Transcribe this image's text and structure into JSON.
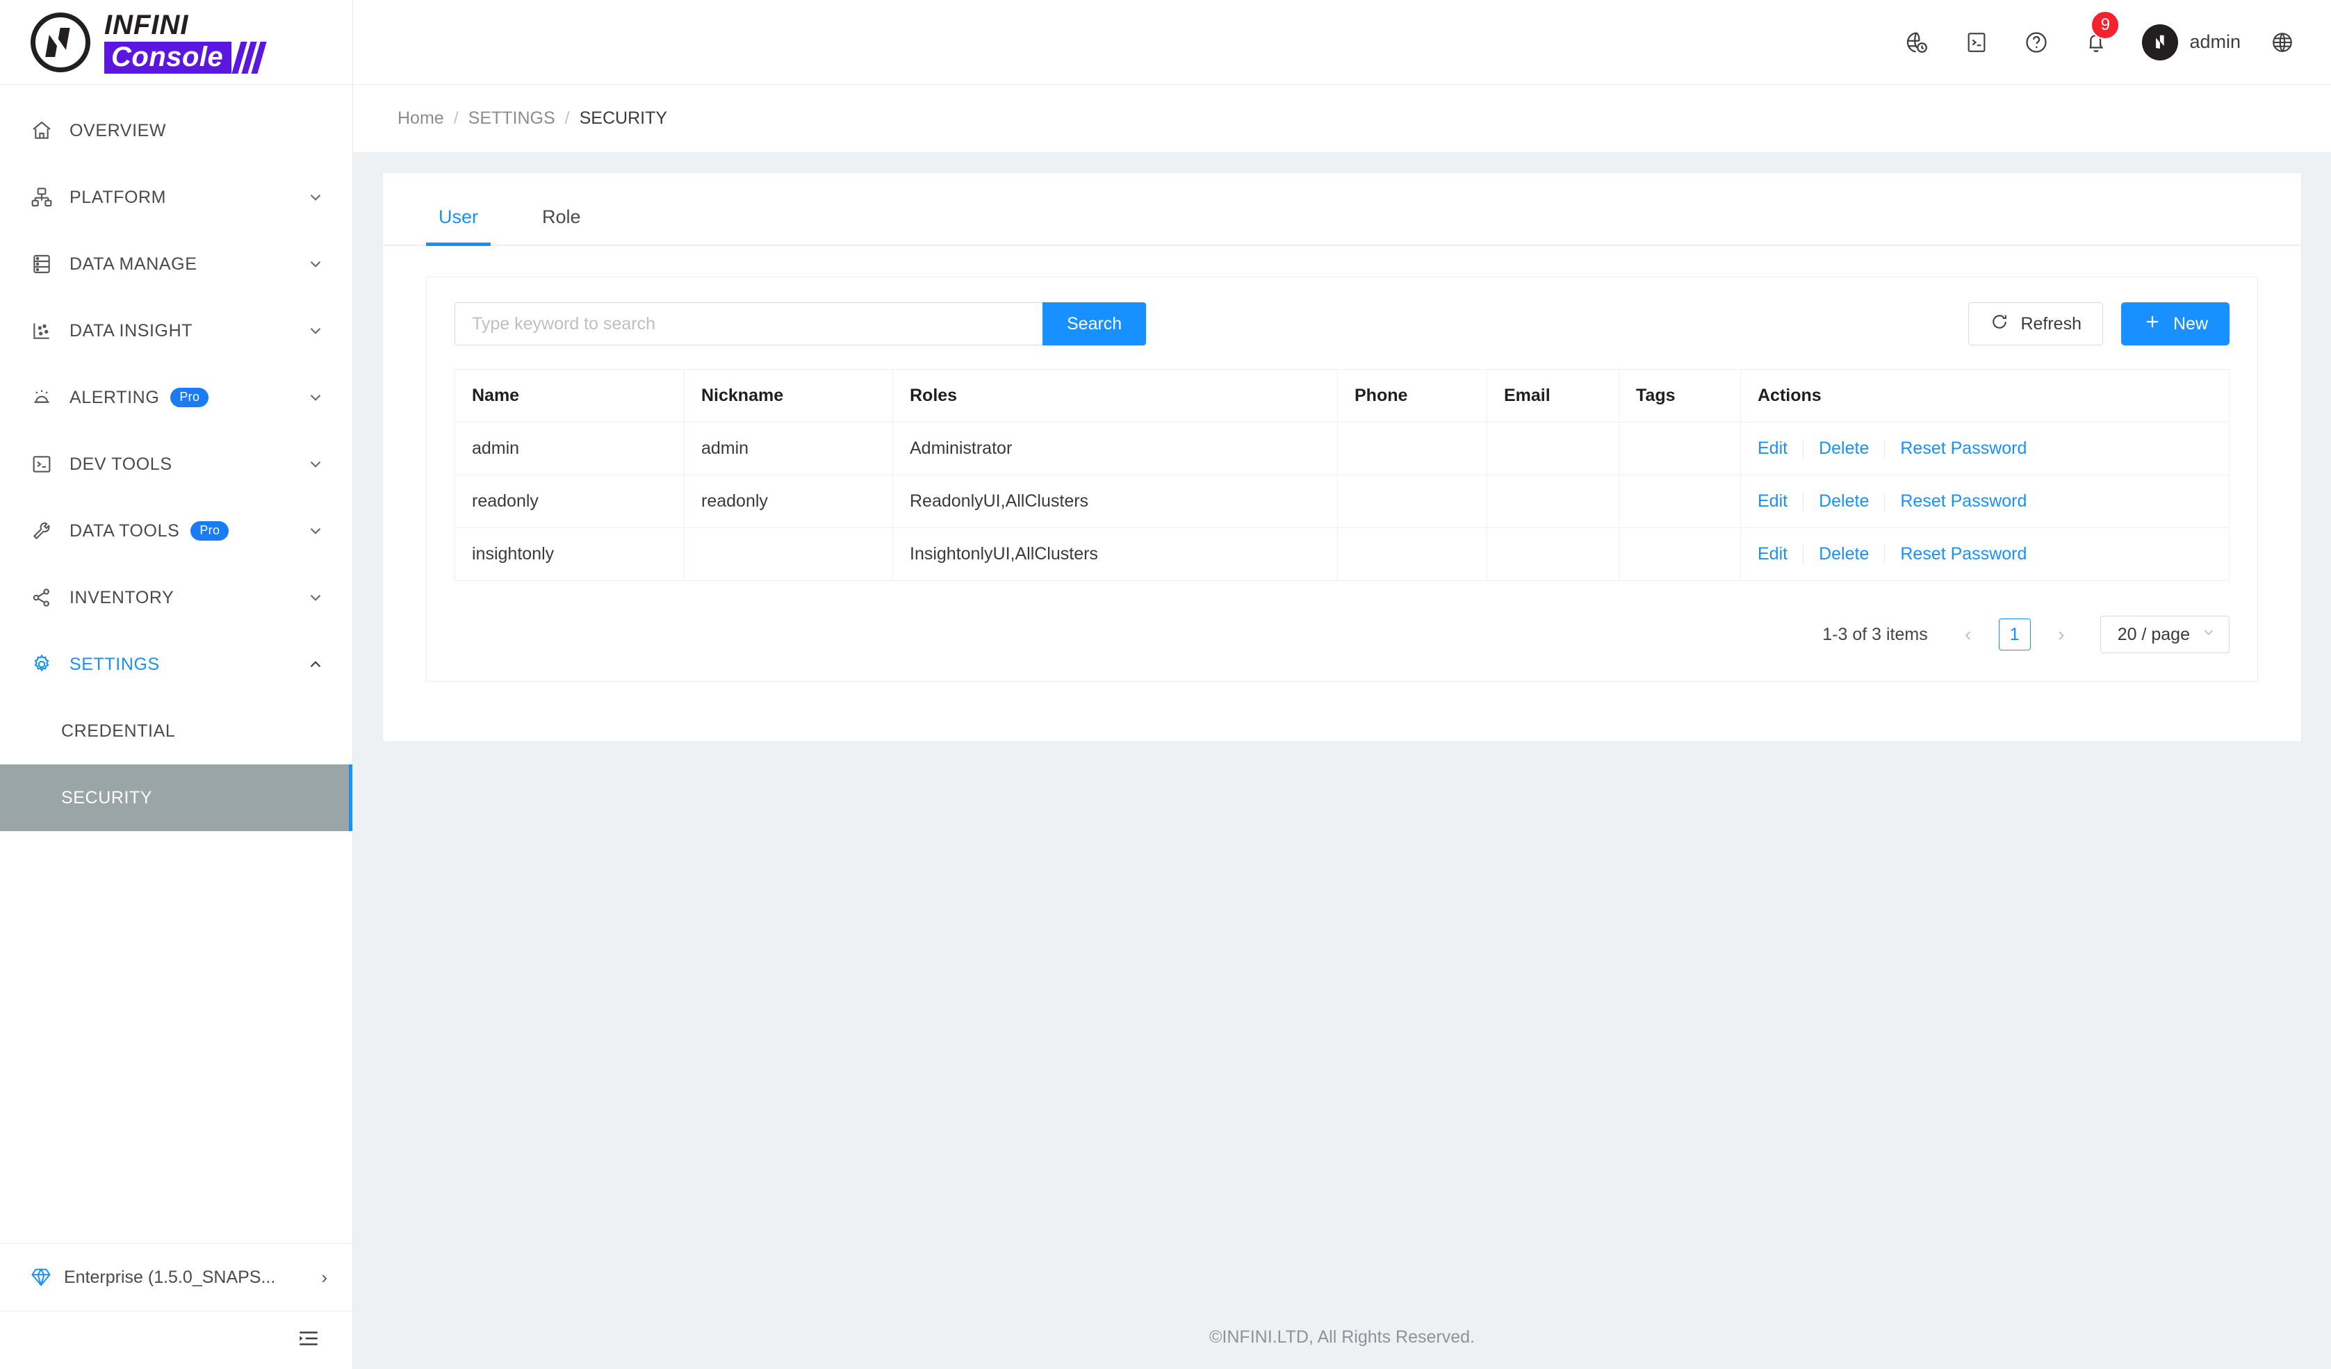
{
  "brand": {
    "name_top": "INFINI",
    "name_bottom": "Console",
    "purple": "#5b17e0"
  },
  "sidebar": {
    "items": [
      {
        "label": "OVERVIEW",
        "icon": "home-icon",
        "expandable": false,
        "badge": ""
      },
      {
        "label": "PLATFORM",
        "icon": "platform-icon",
        "expandable": true,
        "badge": ""
      },
      {
        "label": "DATA MANAGE",
        "icon": "database-icon",
        "expandable": true,
        "badge": ""
      },
      {
        "label": "DATA INSIGHT",
        "icon": "chart-icon",
        "expandable": true,
        "badge": ""
      },
      {
        "label": "ALERTING",
        "icon": "alarm-icon",
        "expandable": true,
        "badge": "Pro"
      },
      {
        "label": "DEV TOOLS",
        "icon": "terminal-icon",
        "expandable": true,
        "badge": ""
      },
      {
        "label": "DATA TOOLS",
        "icon": "wrench-icon",
        "expandable": true,
        "badge": "Pro"
      },
      {
        "label": "INVENTORY",
        "icon": "share-nodes-icon",
        "expandable": true,
        "badge": ""
      },
      {
        "label": "SETTINGS",
        "icon": "gear-icon",
        "expandable": true,
        "badge": "",
        "active": true
      }
    ],
    "sub_items": [
      {
        "label": "CREDENTIAL",
        "selected": false
      },
      {
        "label": "SECURITY",
        "selected": true
      }
    ],
    "footer": {
      "edition": "Enterprise (1.5.0_SNAPS...",
      "gem_icon": "gem-icon",
      "arrow_icon": "chevron-right-icon",
      "collapse_icon": "collapse-menu-icon"
    },
    "accent": "#1890ff",
    "selected_bg": "#9aa5a8"
  },
  "topbar": {
    "icons": [
      {
        "name": "globe-clock-icon"
      },
      {
        "name": "console-terminal-icon"
      },
      {
        "name": "help-circle-icon"
      }
    ],
    "notification": {
      "icon": "bell-icon",
      "count": "9",
      "color": "#f5222d"
    },
    "user": {
      "avatar_icon": "infini-avatar-icon",
      "name": "admin"
    },
    "language": {
      "icon": "globe-icon"
    }
  },
  "breadcrumb": {
    "items": [
      {
        "label": "Home",
        "current": false
      },
      {
        "label": "SETTINGS",
        "current": false
      },
      {
        "label": "SECURITY",
        "current": true
      }
    ],
    "separator": "/"
  },
  "tabs": [
    {
      "label": "User",
      "active": true
    },
    {
      "label": "Role",
      "active": false
    }
  ],
  "toolbar": {
    "search_placeholder": "Type keyword to search",
    "search_value": "",
    "search_label": "Search",
    "refresh_label": "Refresh",
    "refresh_icon": "refresh-icon",
    "new_label": "New",
    "new_icon": "plus-icon"
  },
  "table": {
    "columns": [
      "Name",
      "Nickname",
      "Roles",
      "Phone",
      "Email",
      "Tags",
      "Actions"
    ],
    "rows": [
      {
        "name": "admin",
        "nickname": "admin",
        "roles": "Administrator",
        "phone": "",
        "email": "",
        "tags": ""
      },
      {
        "name": "readonly",
        "nickname": "readonly",
        "roles": "ReadonlyUI,AllClusters",
        "phone": "",
        "email": "",
        "tags": ""
      },
      {
        "name": "insightonly",
        "nickname": "",
        "roles": "InsightonlyUI,AllClusters",
        "phone": "",
        "email": "",
        "tags": ""
      }
    ],
    "actions": [
      "Edit",
      "Delete",
      "Reset Password"
    ]
  },
  "pagination": {
    "total_text": "1-3 of 3 items",
    "prev_icon": "chevron-left-icon",
    "next_icon": "chevron-right-icon",
    "current_page": "1",
    "page_size": "20 / page",
    "caret_icon": "chevron-down-icon"
  },
  "footer": {
    "copyright": "©INFINI.LTD, All Rights Reserved."
  }
}
